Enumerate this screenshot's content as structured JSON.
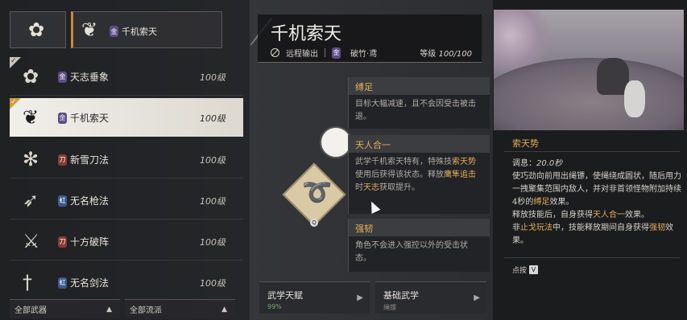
{
  "weapon_slots": {
    "slot1_icon": "weapon-glyph-icon",
    "slot2_name": "千机索天",
    "slot2_badge": "金"
  },
  "weapon_list": [
    {
      "name": "天志垂象",
      "level": "100级",
      "badge": "金",
      "badge_color": "purple",
      "checked": true,
      "selected": false,
      "icon": "bracer-icon"
    },
    {
      "name": "千机索天",
      "level": "100级",
      "badge": "金",
      "badge_color": "purple",
      "checked": true,
      "selected": true,
      "icon": "rope-dart-icon"
    },
    {
      "name": "新雪刀法",
      "level": "100级",
      "badge": "刀",
      "badge_color": "red",
      "checked": false,
      "selected": false,
      "icon": "snowflake-sword-icon"
    },
    {
      "name": "无名枪法",
      "level": "100级",
      "badge": "虹",
      "badge_color": "blue",
      "checked": false,
      "selected": false,
      "icon": "spear-icon"
    },
    {
      "name": "十方破阵",
      "level": "100级",
      "badge": "刀",
      "badge_color": "red",
      "checked": false,
      "selected": false,
      "icon": "crossed-blades-icon"
    },
    {
      "name": "无名剑法",
      "level": "100级",
      "badge": "虹",
      "badge_color": "blue",
      "checked": false,
      "selected": false,
      "icon": "sword-icon"
    }
  ],
  "filters": {
    "weapons": "全部武器",
    "schools": "全部流派"
  },
  "skill": {
    "title": "千机索天",
    "type": "远程输出",
    "school": "破竹·鸢",
    "level_label": "等级",
    "level_value": "100/100"
  },
  "tooltips": {
    "t1_head": "缚足",
    "t1_body": "目标大幅减速，且不会因受击被击退。",
    "t2_head": "天人合一",
    "t2_body_a": "武学千机索天特有，特殊技",
    "t2_body_b": "索天势",
    "t2_body_c": "使用后获得该状态。",
    "t2_body_d": "释放",
    "t2_body_e": "鹰隼追击",
    "t2_body_f": "时",
    "t2_body_g": "天志",
    "t2_body_h": "获取提升。",
    "t3_head": "强韧",
    "t3_body": "角色不会进入强控以外的受击状态。"
  },
  "bottom_buttons": {
    "talent_label": "武学天赋",
    "talent_value": "99%",
    "basic_label": "基础武学",
    "basic_sub": "绳镖"
  },
  "skill_detail": {
    "name": "索天势",
    "cooldown_label": "调息：",
    "cooldown_value": "20.0秒",
    "desc1": "使巧劲向前甩出绳镖，使绳绕成圆状，随后用力一拽聚集范围内敌人，并对非首领怪物附加持续4秒的",
    "desc1_hl": "缚足",
    "desc1_end": "效果。",
    "desc2_a": "释放技能后，自身获得",
    "desc2_hl": "天人合一",
    "desc2_b": "效果。",
    "desc3_a": "非",
    "desc3_hl": "止戈玩法",
    "desc3_b": "中，技能释放期间自身获得",
    "desc3_hl2": "强韧",
    "desc3_c": "效果。",
    "hold_label": "点按",
    "hold_key": "V"
  },
  "key_hint": "Q",
  "colors": {
    "accent": "#e3ad56",
    "selected_row": "#f1efe9",
    "slot_accent": "#c8893a"
  }
}
